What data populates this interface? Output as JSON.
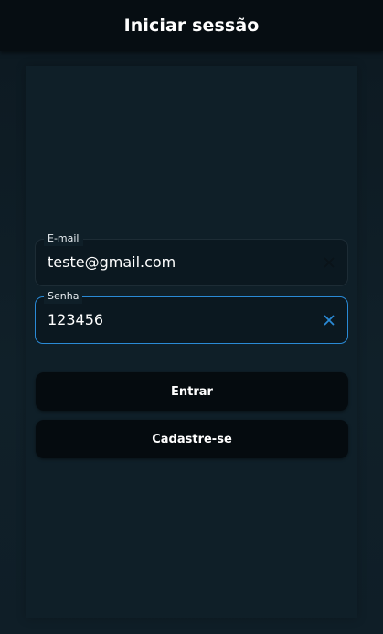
{
  "app_bar": {
    "title": "Iniciar sessão"
  },
  "form": {
    "email": {
      "label": "E-mail",
      "value": "teste@gmail.com",
      "clear_icon": "close-icon"
    },
    "password": {
      "label": "Senha",
      "value": "123456",
      "clear_icon": "close-icon",
      "focused": true
    }
  },
  "buttons": {
    "login_label": "Entrar",
    "signup_label": "Cadastre-se"
  },
  "colors": {
    "app_bar": "#060d12",
    "background": "#0f1c25",
    "focus_accent": "#2a8ad6",
    "button": "#050b0f"
  }
}
